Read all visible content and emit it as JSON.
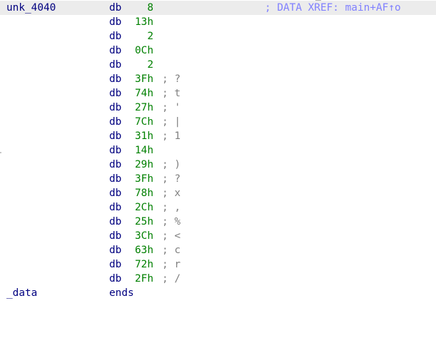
{
  "listing": {
    "label": "unk_4040",
    "xref": "; DATA XREF: main+AF↑o",
    "rows": [
      {
        "mnemonic": "db",
        "operand": "8",
        "comment": ""
      },
      {
        "mnemonic": "db",
        "operand": "13h",
        "comment": ""
      },
      {
        "mnemonic": "db",
        "operand": "2",
        "comment": ""
      },
      {
        "mnemonic": "db",
        "operand": "0Ch",
        "comment": ""
      },
      {
        "mnemonic": "db",
        "operand": "2",
        "comment": ""
      },
      {
        "mnemonic": "db",
        "operand": "3Fh",
        "comment": "; ?"
      },
      {
        "mnemonic": "db",
        "operand": "74h",
        "comment": "; t"
      },
      {
        "mnemonic": "db",
        "operand": "27h",
        "comment": "; '"
      },
      {
        "mnemonic": "db",
        "operand": "7Ch",
        "comment": "; |"
      },
      {
        "mnemonic": "db",
        "operand": "31h",
        "comment": "; 1"
      },
      {
        "mnemonic": "db",
        "operand": "14h",
        "comment": ""
      },
      {
        "mnemonic": "db",
        "operand": "29h",
        "comment": "; )"
      },
      {
        "mnemonic": "db",
        "operand": "3Fh",
        "comment": "; ?"
      },
      {
        "mnemonic": "db",
        "operand": "78h",
        "comment": "; x"
      },
      {
        "mnemonic": "db",
        "operand": "2Ch",
        "comment": "; ,"
      },
      {
        "mnemonic": "db",
        "operand": "25h",
        "comment": "; %"
      },
      {
        "mnemonic": "db",
        "operand": "3Ch",
        "comment": "; <"
      },
      {
        "mnemonic": "db",
        "operand": "63h",
        "comment": "; c"
      },
      {
        "mnemonic": "db",
        "operand": "72h",
        "comment": "; r"
      },
      {
        "mnemonic": "db",
        "operand": "2Fh",
        "comment": "; /"
      }
    ]
  },
  "segment_end": {
    "name": "_data",
    "directive": "ends"
  },
  "colors": {
    "label": "#000080",
    "mnemonic": "#000080",
    "operand": "#008000",
    "comment": "#808080",
    "xref": "#8080ff",
    "highlight": "#ececec"
  }
}
